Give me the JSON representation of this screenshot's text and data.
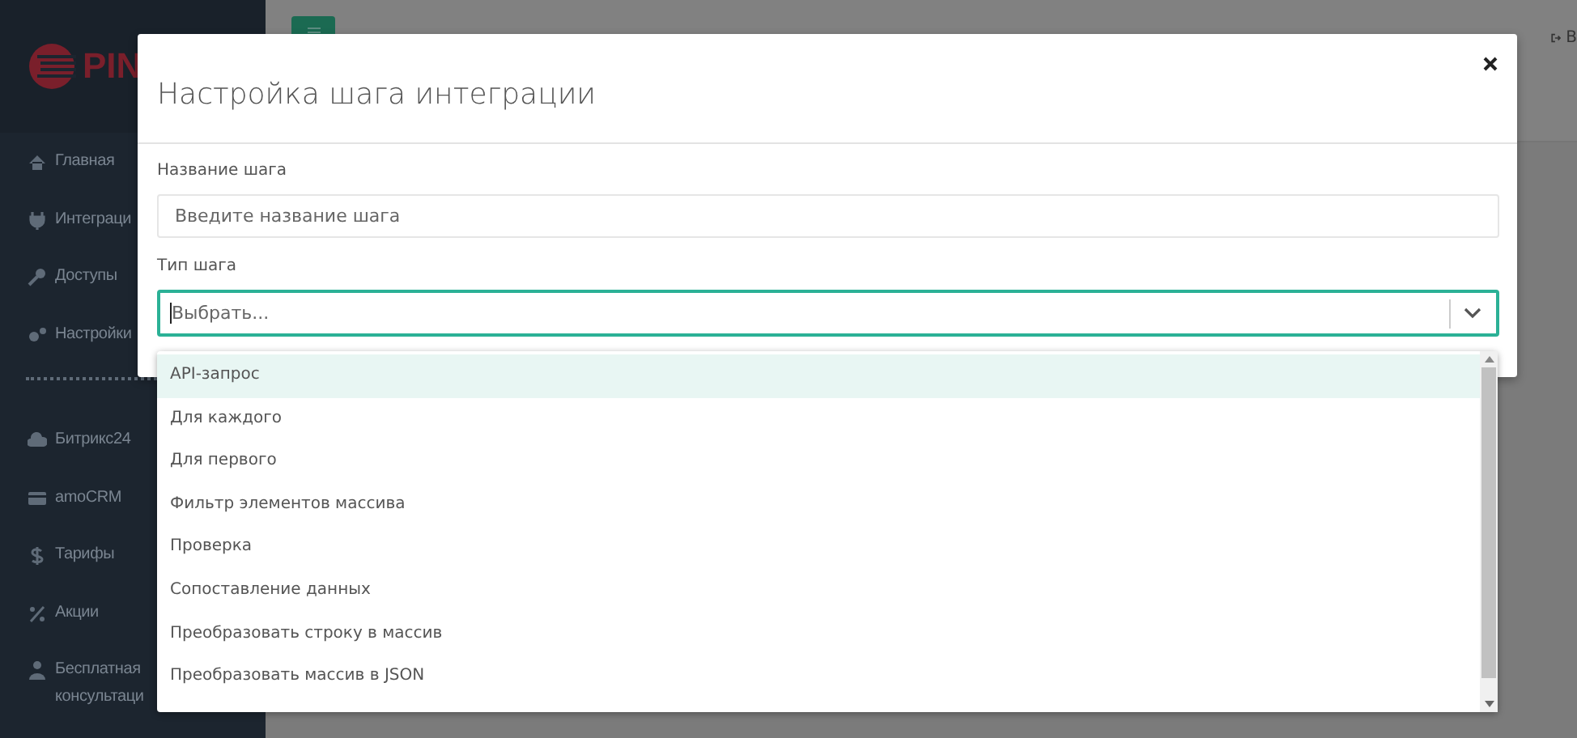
{
  "sidebar": {
    "logo": "PIN",
    "items": [
      {
        "label": "Главная"
      },
      {
        "label": "Интеграци"
      },
      {
        "label": "Доступы"
      },
      {
        "label": "Настройки"
      },
      {
        "kind": "divider"
      },
      {
        "label": "Битрикс24"
      },
      {
        "label": "amoCRM"
      },
      {
        "label": "Тарифы"
      },
      {
        "label": "Акции"
      },
      {
        "label": "Бесплатная консультаци"
      }
    ]
  },
  "topbar": {
    "logout": "В"
  },
  "modal": {
    "title": "Настройка шага интеграции",
    "fields": [
      {
        "label": "Название шага",
        "kind": "input",
        "placeholder": "Введите название шага"
      },
      {
        "label": "Тип шага",
        "kind": "select",
        "placeholder": "Выбрать...",
        "focused": true
      }
    ],
    "dropdown": [
      {
        "label": "API-запрос",
        "selected": true
      },
      {
        "label": "Для каждого",
        "selected": false
      },
      {
        "label": "Для первого",
        "selected": false
      },
      {
        "label": "Фильтр элементов массива",
        "selected": false
      },
      {
        "label": "Проверка",
        "selected": false
      },
      {
        "label": "Сопоставление данных",
        "selected": false
      },
      {
        "label": "Преобразовать строку в массив",
        "selected": false
      },
      {
        "label": "Преобразовать массив в JSON",
        "selected": false
      }
    ]
  }
}
